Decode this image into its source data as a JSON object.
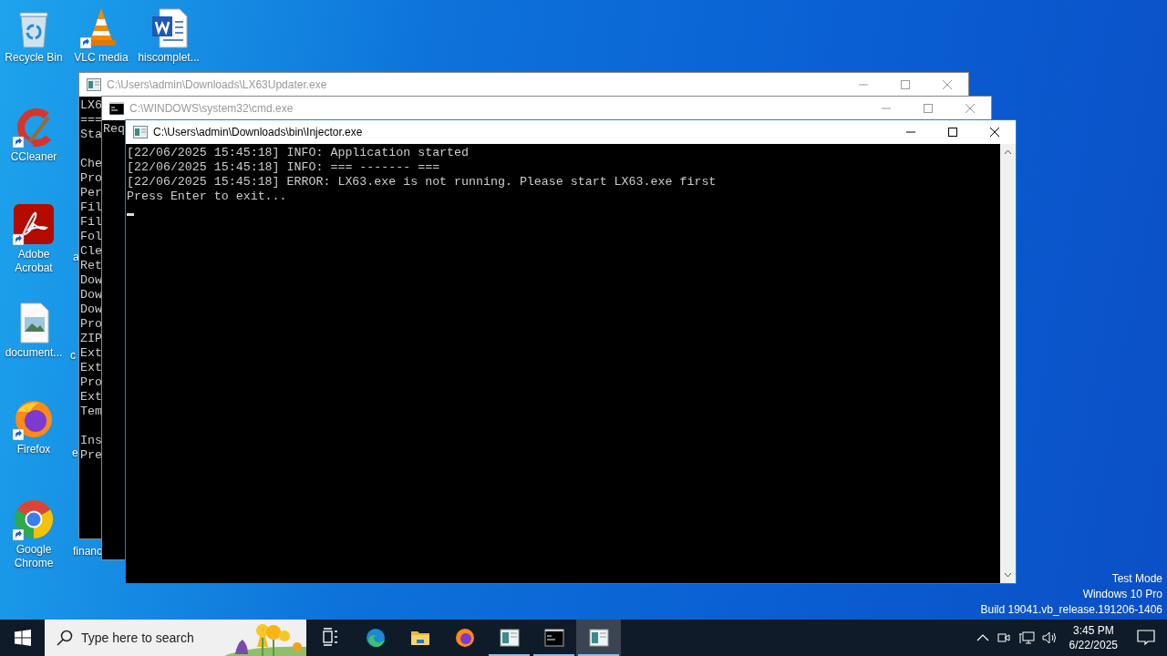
{
  "desktop_icons": [
    {
      "label": "Recycle Bin",
      "kind": "recycle",
      "shortcut": false
    },
    {
      "label": "VLC media",
      "kind": "vlc",
      "shortcut": true
    },
    {
      "label": "hiscomplet...",
      "kind": "word",
      "shortcut": false
    },
    {
      "label": "CCleaner",
      "kind": "ccleaner",
      "shortcut": true
    },
    {
      "label": "Adobe Acrobat",
      "kind": "acrobat",
      "shortcut": true
    },
    {
      "label": "document...",
      "kind": "image-file",
      "shortcut": false
    },
    {
      "label": "Firefox",
      "kind": "firefox",
      "shortcut": true
    },
    {
      "label": "Google Chrome",
      "kind": "chrome",
      "shortcut": true
    }
  ],
  "hidden_icon_labels": [
    "a",
    "c",
    "e",
    "financ"
  ],
  "windows": [
    {
      "title": "C:\\Users\\admin\\Downloads\\LX63Updater.exe",
      "kind": "app",
      "active": false,
      "blocks": [
        [
          "LX6",
          "===",
          "Sta"
        ],
        [
          "Che",
          "Pro",
          "Per",
          "Fil",
          "Fil",
          "Fol",
          "Cle",
          "Ret",
          "Dow",
          "Dow",
          "Dow",
          "Pro",
          "ZIP",
          "Ext",
          "Ext",
          "Pro",
          "Ext",
          "Tem"
        ],
        [
          "Ins",
          "Pre"
        ]
      ]
    },
    {
      "title": "C:\\WINDOWS\\system32\\cmd.exe",
      "kind": "cmd",
      "active": false,
      "blocks": [
        [
          "Req"
        ]
      ]
    },
    {
      "title": "C:\\Users\\admin\\Downloads\\bin\\Injector.exe",
      "kind": "app",
      "active": true,
      "scrollbar": true,
      "cursor": true,
      "blocks": [
        [
          "[22/06/2025 15:45:18] INFO: Application started",
          "[22/06/2025 15:45:18] INFO: === ------- ===",
          "[22/06/2025 15:45:18] ERROR: LX63.exe is not running. Please start LX63.exe first",
          "Press Enter to exit..."
        ]
      ]
    }
  ],
  "system_watermark": [
    "Test Mode",
    "Windows 10 Pro",
    "Build 19041.vb_release.191206-1406"
  ],
  "taskbar": {
    "search_placeholder": "Type here to search",
    "apps": [
      {
        "kind": "task-view",
        "running": false,
        "active": false
      },
      {
        "kind": "edge",
        "running": false,
        "active": false
      },
      {
        "kind": "explorer",
        "running": false,
        "active": false
      },
      {
        "kind": "firefox",
        "running": false,
        "active": false
      },
      {
        "kind": "app",
        "running": true,
        "active": false
      },
      {
        "kind": "cmd",
        "running": true,
        "active": false
      },
      {
        "kind": "app",
        "running": true,
        "active": true
      }
    ],
    "time": "3:45 PM",
    "date": "6/22/2025"
  }
}
